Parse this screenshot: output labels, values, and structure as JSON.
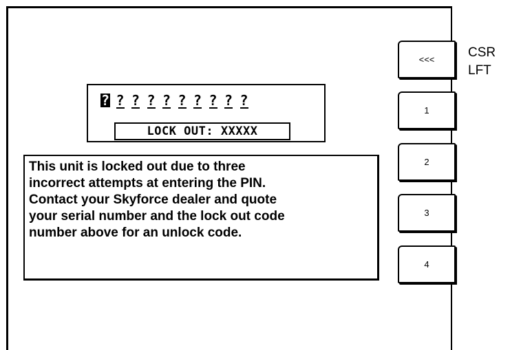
{
  "pin": {
    "characters": [
      "?",
      "?",
      "?",
      "?",
      "?",
      "?",
      "?",
      "?",
      "?",
      "?"
    ],
    "lockout_text": "LOCK OUT: XXXXX"
  },
  "message": "This unit is locked out due to three\nincorrect attempts at entering the PIN.\nContact your Skyforce dealer and quote\nyour serial number and the lock out code\nnumber above for an unlock code.",
  "softkeys": {
    "cursor_left": "<<<",
    "key1": "1",
    "key2": "2",
    "key3": "3",
    "key4": "4"
  },
  "softkey_caption": "CSR\nLFT"
}
